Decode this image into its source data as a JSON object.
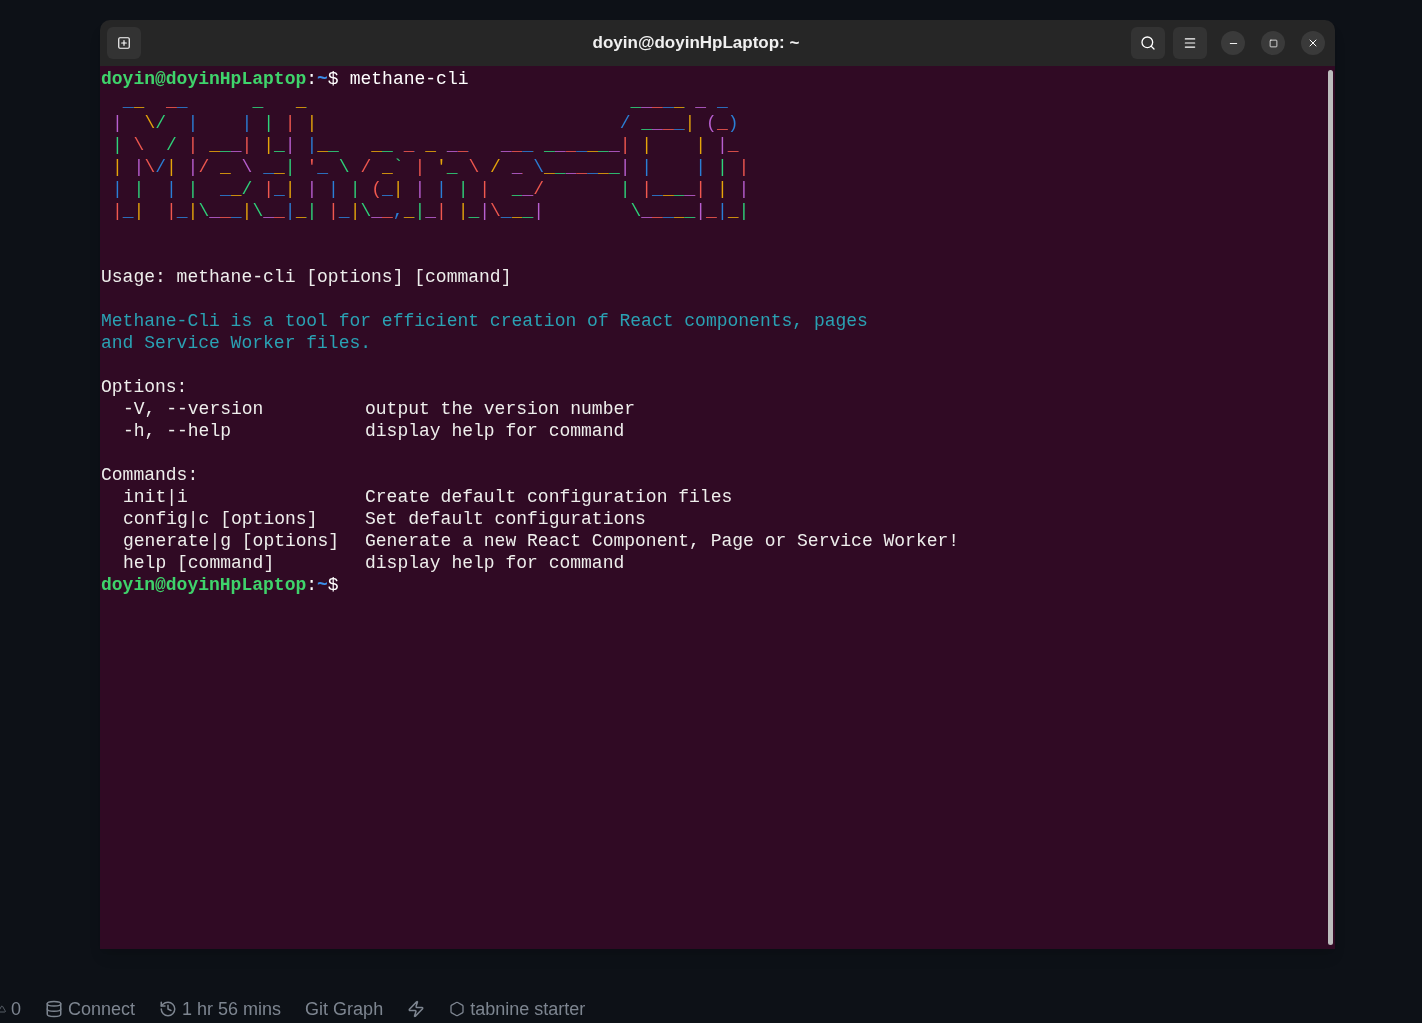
{
  "window": {
    "title": "doyin@doyinHpLaptop: ~"
  },
  "terminal": {
    "lines": [
      {
        "kind": "prompt",
        "user": "doyin@doyinHpLaptop",
        "separator": ":",
        "path": "~",
        "symbol": "$",
        "command": "methane-cli"
      },
      {
        "kind": "art",
        "rows": [
          " __  __      _   _                              _____ _ _ ",
          "|  \\/  |    | | | |                            / ____| (_)",
          "| \\  / | ___| |_| |__   __ _ _ __   ___ _______| |    | |_ ",
          "| |\\/| |/ _ \\ __| '_ \\ / _` | '_ \\ / _ \\_______| |    | | |",
          "| |  | |  __/ |_| | | | (_| | | | |  __/       | |____| | |",
          "|_|  |_|\\___|\\__|_| |_|\\__,_|_| |_|\\___|        \\_____|_|_|"
        ]
      },
      {
        "kind": "blank"
      },
      {
        "kind": "blank"
      },
      {
        "kind": "text",
        "text": "Usage: methane-cli [options] [command]"
      },
      {
        "kind": "blank"
      },
      {
        "kind": "info",
        "text": "Methane-Cli is a tool for efficient creation of React components, pages"
      },
      {
        "kind": "info",
        "text": "and Service Worker files."
      },
      {
        "kind": "blank"
      },
      {
        "kind": "text",
        "text": "Options:"
      },
      {
        "kind": "entry",
        "name": "-V, --version",
        "description": "output the version number"
      },
      {
        "kind": "entry",
        "name": "-h, --help",
        "description": "display help for command"
      },
      {
        "kind": "blank"
      },
      {
        "kind": "text",
        "text": "Commands:"
      },
      {
        "kind": "entry",
        "name": "init|i",
        "description": "Create default configuration files"
      },
      {
        "kind": "entry",
        "name": "config|c [options]",
        "description": "Set default configurations"
      },
      {
        "kind": "entry",
        "name": "generate|g [options]",
        "description": "Generate a new React Component, Page or Service Worker!"
      },
      {
        "kind": "entry",
        "name": "help [command]",
        "description": "display help for command"
      },
      {
        "kind": "prompt",
        "user": "doyin@doyinHpLaptop",
        "separator": ":",
        "path": "~",
        "symbol": "$"
      }
    ]
  },
  "status_bar": [
    {
      "kind": "partial",
      "text": "0"
    },
    {
      "kind": "database",
      "text": "Connect"
    },
    {
      "kind": "history",
      "text": "1 hr 56 mins"
    },
    {
      "kind": "plain",
      "text": "Git Graph"
    },
    {
      "kind": "zap"
    },
    {
      "kind": "hexagon",
      "text": "tabnine starter"
    }
  ]
}
